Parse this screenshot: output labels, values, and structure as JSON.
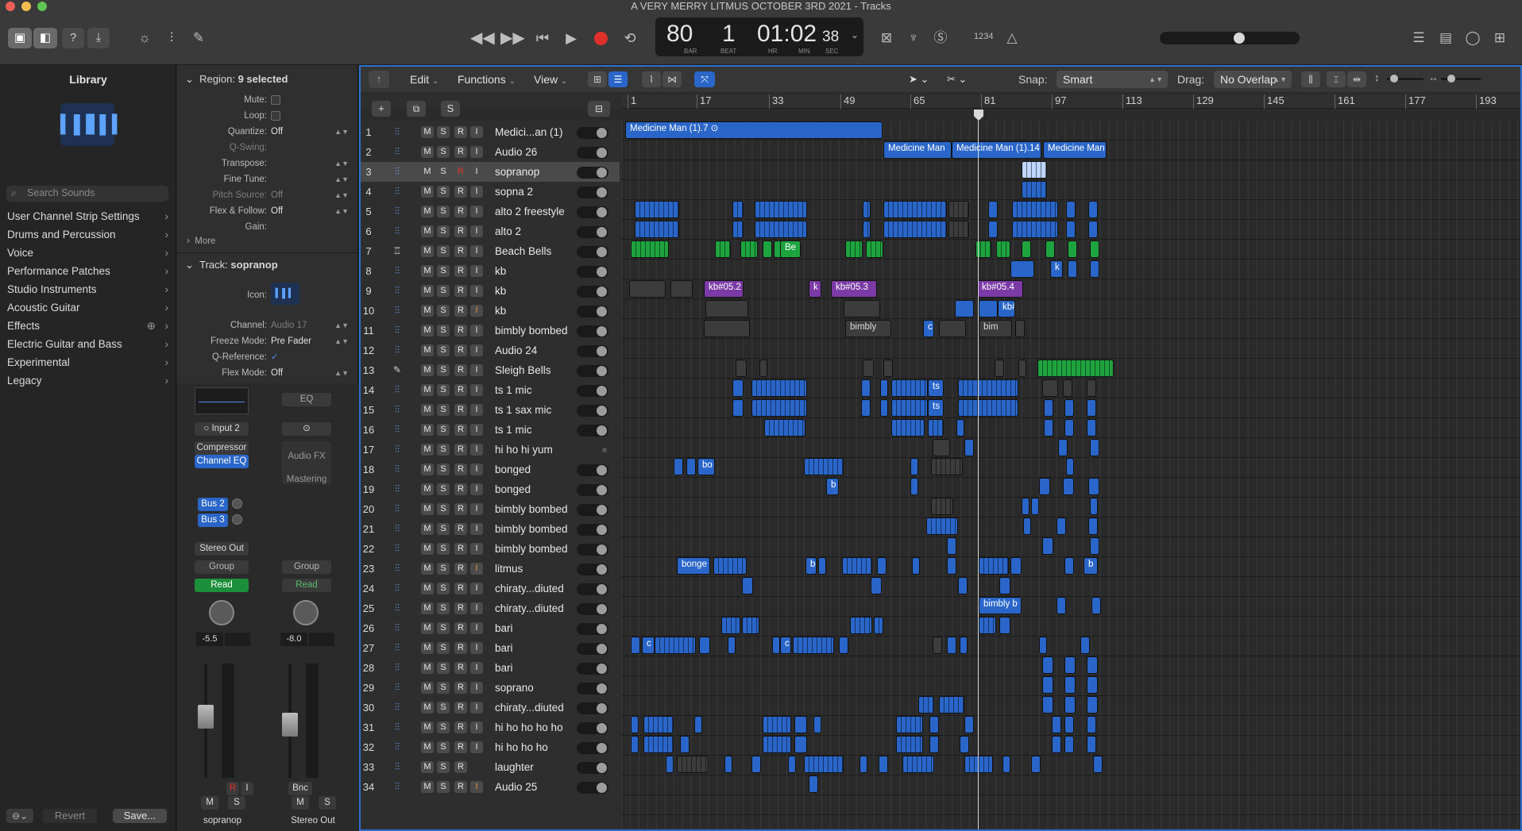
{
  "window": {
    "title": "A VERY MERRY LITMUS OCTOBER 3RD 2021 - Tracks"
  },
  "lcd": {
    "tempo": "80",
    "beat": "1",
    "time": "01:02",
    "time_small": "38",
    "bar_label": "BAR",
    "beat_label": "BEAT",
    "hr_label": "HR",
    "min_label": "MIN",
    "sec_label": "SEC",
    "key_label": "1234"
  },
  "library": {
    "title": "Library",
    "search_placeholder": "Search Sounds",
    "items": [
      "User Channel Strip Settings",
      "Drums and Percussion",
      "Voice",
      "Performance Patches",
      "Studio Instruments",
      "Acoustic Guitar",
      "Effects",
      "Electric Guitar and Bass",
      "Experimental",
      "Legacy"
    ],
    "revert": "Revert",
    "save": "Save..."
  },
  "inspector": {
    "region_header_prefix": "Region:",
    "region_header_value": "9 selected",
    "region_rows": [
      {
        "label": "Mute:",
        "value": "",
        "check": true,
        "dim": false
      },
      {
        "label": "Loop:",
        "value": "",
        "check": true,
        "dim": false
      },
      {
        "label": "Quantize:",
        "value": "Off",
        "check": false,
        "dim": false
      },
      {
        "label": "Q-Swing:",
        "value": "",
        "check": false,
        "dim": true
      },
      {
        "label": "Transpose:",
        "value": "",
        "check": false,
        "dim": false
      },
      {
        "label": "Fine Tune:",
        "value": "",
        "check": false,
        "dim": false
      },
      {
        "label": "Pitch Source:",
        "value": "Off",
        "check": false,
        "dim": true
      },
      {
        "label": "Flex & Follow:",
        "value": "Off",
        "check": false,
        "dim": false
      },
      {
        "label": "Gain:",
        "value": "",
        "check": false,
        "dim": false
      }
    ],
    "more": "More",
    "track_header_prefix": "Track:",
    "track_header_value": "sopranop",
    "track_rows": [
      {
        "label": "Icon:",
        "value": "",
        "dim": false
      },
      {
        "label": "Channel:",
        "value": "Audio 17",
        "dim": true
      },
      {
        "label": "Freeze Mode:",
        "value": "Pre Fader",
        "dim": false
      },
      {
        "label": "Q-Reference:",
        "value": "✓",
        "dim": false
      },
      {
        "label": "Flex Mode:",
        "value": "Off",
        "dim": false
      }
    ],
    "strip1": {
      "input": "Input 2",
      "fx1": "Compressor",
      "fx2": "Channel EQ",
      "send1": "Bus 2",
      "send2": "Bus 3",
      "output": "Stereo Out",
      "group": "Group",
      "auto": "Read",
      "volume": "-5.5",
      "name": "sopranop",
      "m": "M",
      "s": "S",
      "r": "R",
      "i": "I"
    },
    "strip2": {
      "eq": "EQ",
      "fx": "Audio FX",
      "mastering": "Mastering",
      "group": "Group",
      "auto": "Read",
      "volume": "-8.0",
      "name": "Stereo Out",
      "bnc": "Bnc",
      "m": "M",
      "s": "S"
    }
  },
  "toolbar": {
    "edit": "Edit",
    "functions": "Functions",
    "view": "View",
    "snap_label": "Snap:",
    "snap_value": "Smart",
    "drag_label": "Drag:",
    "drag_value": "No Overlap"
  },
  "ruler": [
    "1",
    "17",
    "33",
    "49",
    "65",
    "81",
    "97",
    "113",
    "129",
    "145",
    "161",
    "177",
    "193"
  ],
  "tracks": [
    {
      "n": "1",
      "name": "Medici...an (1)"
    },
    {
      "n": "2",
      "name": "Audio 26"
    },
    {
      "n": "3",
      "name": "sopranop"
    },
    {
      "n": "4",
      "name": "sopna 2"
    },
    {
      "n": "5",
      "name": "alto 2 freestyle"
    },
    {
      "n": "6",
      "name": "alto 2"
    },
    {
      "n": "7",
      "name": "Beach Bells"
    },
    {
      "n": "8",
      "name": "kb"
    },
    {
      "n": "9",
      "name": "kb"
    },
    {
      "n": "10",
      "name": "kb"
    },
    {
      "n": "11",
      "name": "bimbly bombed"
    },
    {
      "n": "12",
      "name": "Audio 24"
    },
    {
      "n": "13",
      "name": "Sleigh Bells"
    },
    {
      "n": "14",
      "name": "ts 1 mic"
    },
    {
      "n": "15",
      "name": "ts 1 sax mic"
    },
    {
      "n": "16",
      "name": "ts 1 mic"
    },
    {
      "n": "17",
      "name": "hi ho hi yum"
    },
    {
      "n": "18",
      "name": "bonged"
    },
    {
      "n": "19",
      "name": "bonged"
    },
    {
      "n": "20",
      "name": "bimbly bombed"
    },
    {
      "n": "21",
      "name": "bimbly bombed"
    },
    {
      "n": "22",
      "name": "bimbly bombed"
    },
    {
      "n": "23",
      "name": "litmus"
    },
    {
      "n": "24",
      "name": "chiraty...diuted"
    },
    {
      "n": "25",
      "name": "chiraty...diuted"
    },
    {
      "n": "26",
      "name": "bari"
    },
    {
      "n": "27",
      "name": "bari"
    },
    {
      "n": "28",
      "name": "bari"
    },
    {
      "n": "29",
      "name": "soprano"
    },
    {
      "n": "30",
      "name": "chiraty...diuted"
    },
    {
      "n": "31",
      "name": "hi ho ho ho ho"
    },
    {
      "n": "32",
      "name": "hi ho ho ho"
    },
    {
      "n": "33",
      "name": "laughter"
    },
    {
      "n": "34",
      "name": "Audio 25"
    }
  ],
  "labels": {
    "medicine_1": "Medicine Man (1).7",
    "medicine_2": "Medicine Man",
    "medicine_3": "Medicine Man (1).14",
    "medicine_4": "Medicine Man",
    "be": "Be",
    "k1": "k",
    "k2": "k",
    "kb52": "kb#05.2",
    "kb53": "kb#05.3",
    "kb54": "kb#05.4",
    "kbh": "kb#",
    "bimbly": "bimbly",
    "c": "c",
    "bim": "bim",
    "ts1": "ts",
    "ts2": "ts",
    "bo": "bo",
    "b1": "b",
    "b2": "b",
    "b3": "b",
    "bonge": "bonge",
    "bimblyb": "bimbly b",
    "c2": "c",
    "c3": "c"
  },
  "colors": {
    "accent": "#2d6fd0",
    "audio_region": "#2a66c9",
    "midi_green": "#1ea43f",
    "midi_purple": "#7b3aa5",
    "record": "#e0302a"
  }
}
